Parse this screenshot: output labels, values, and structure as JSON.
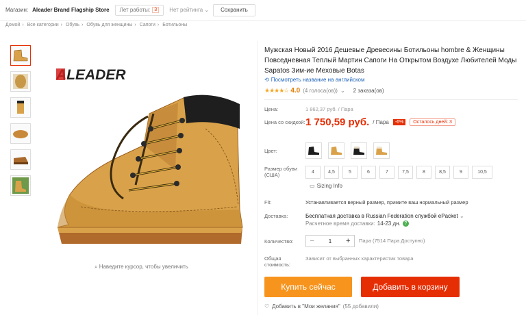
{
  "store_bar": {
    "shop_label": "Магазин:",
    "shop_name": "Aleader Brand Flagship Store",
    "years_label": "Лет работы:",
    "years_value": "3",
    "rating_label": "Нет рейтинга",
    "save_label": "Сохранить"
  },
  "breadcrumb": [
    "Домой",
    "Все категории",
    "Обувь",
    "Обувь для женщины",
    "Сапоги",
    "Ботильоны"
  ],
  "gallery": {
    "logo_text": "ALEADER",
    "zoom_hint": "Наведите курсор, чтобы увеличить"
  },
  "product": {
    "title": "Мужская Новый 2016 Дешевые Древесины Ботильоны hombre & Женщины Повседневная Теплый Мартин Сапоги На Открытом Воздухе Любителей Моды Sapatos Зим-ие Меховые Botas",
    "translate_link": "Посмотреть название на английском",
    "stars": "★★★★☆",
    "rating": "4.0",
    "reviews": "(4 голоса(ов))",
    "orders": "2 заказа(ов)"
  },
  "price": {
    "price_label": "Цена:",
    "old_price": "1 862,37 руб. / Пара",
    "discount_label": "Цена со скидкой:",
    "new_price": "1 750,59 руб.",
    "per": "/ Пара",
    "discount": "-6%",
    "days_left": "Осталось дней: 3"
  },
  "color": {
    "label": "Цвет:",
    "options": [
      "black-boot",
      "wheat-boot",
      "black-fur",
      "wheat-fur"
    ]
  },
  "size": {
    "label": "Размер обуви (США)",
    "options": [
      "4",
      "4,5",
      "5",
      "6",
      "7",
      "7,5",
      "8",
      "8,5",
      "9",
      "10,5"
    ],
    "sizing_info": "Sizing Info"
  },
  "fit": {
    "label": "Fit:",
    "value": "Устанавливается верный размер, примите ваш нормальный размер"
  },
  "shipping": {
    "label": "Доставка:",
    "line1": "Бесплатная доставка в Russian Federation службой ePacket",
    "line2_label": "Расчетное время доставки:",
    "line2_value": "14-23 дн."
  },
  "quantity": {
    "label": "Количество:",
    "value": "1",
    "stock": "Пара (7514 Пара Доступно)"
  },
  "total": {
    "label": "Общая стоимость:",
    "value": "Зависит от выбранных характеристик товара"
  },
  "actions": {
    "buy": "Купить сейчас",
    "cart": "Добавить в корзину",
    "wishlist": "Добавить в \"Мои желания\"",
    "wishlist_count": "(55 добавили)"
  },
  "colors": {
    "accent": "#e62e04",
    "buy": "#f7941d",
    "boot": "#d9a24a",
    "link": "#2266bb"
  }
}
